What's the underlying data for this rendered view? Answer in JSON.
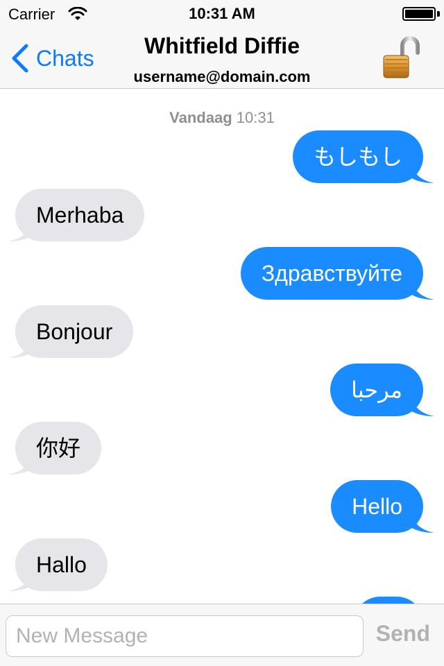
{
  "status_bar": {
    "carrier": "Carrier",
    "time": "10:31 AM",
    "battery_level": 1.0
  },
  "nav": {
    "back_label": "Chats",
    "title": "Whitfield Diffie",
    "subtitle": "username@domain.com",
    "lock_icon": "unlocked-padlock-icon",
    "accent_color": "#0a7aff"
  },
  "conversation": {
    "timestamp_day": "Vandaag",
    "timestamp_time": "10:31",
    "messages": [
      {
        "direction": "out",
        "text": "もしもし"
      },
      {
        "direction": "in",
        "text": "Merhaba"
      },
      {
        "direction": "out",
        "text": "Здравствуйте"
      },
      {
        "direction": "in",
        "text": "Bonjour"
      },
      {
        "direction": "out",
        "text": "مرحبا"
      },
      {
        "direction": "in",
        "text": "你好"
      },
      {
        "direction": "out",
        "text": "Hello"
      },
      {
        "direction": "in",
        "text": "Hallo"
      }
    ],
    "outgoing_color": "#1a8cff",
    "incoming_color": "#e5e5ea"
  },
  "composer": {
    "placeholder": "New Message",
    "value": "",
    "send_label": "Send"
  }
}
